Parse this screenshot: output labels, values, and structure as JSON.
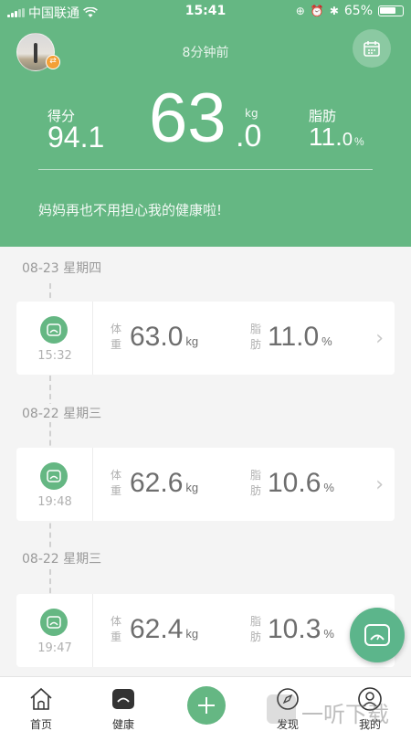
{
  "status_bar": {
    "carrier": "中国联通",
    "time": "15:41",
    "battery": "65%"
  },
  "header": {
    "updated": "8分钟前",
    "score_label": "得分",
    "score_value": "94.1",
    "weight_unit": "kg",
    "weight_int": "63",
    "weight_dec": ".0",
    "fat_label": "脂肪",
    "fat_int": "11.",
    "fat_dec": "0",
    "fat_unit": "%",
    "slogan": "妈妈再也不用担心我的健康啦!"
  },
  "records": [
    {
      "date": "08-23 星期四",
      "time": "15:32",
      "weight_label": "体重",
      "weight": "63.0",
      "weight_unit": "kg",
      "fat_label": "脂肪",
      "fat": "11.0",
      "fat_unit": "%"
    },
    {
      "date": "08-22 星期三",
      "time": "19:48",
      "weight_label": "体重",
      "weight": "62.6",
      "weight_unit": "kg",
      "fat_label": "脂肪",
      "fat": "10.6",
      "fat_unit": "%"
    },
    {
      "date": "08-22 星期三",
      "time": "19:47",
      "weight_label": "体重",
      "weight": "62.4",
      "weight_unit": "kg",
      "fat_label": "脂肪",
      "fat": "10.3",
      "fat_unit": "%"
    }
  ],
  "tabs": [
    {
      "label": "首页",
      "icon": "home-icon"
    },
    {
      "label": "健康",
      "icon": "scale-icon"
    },
    {
      "label": "",
      "icon": "plus-icon"
    },
    {
      "label": "发现",
      "icon": "compass-icon"
    },
    {
      "label": "我的",
      "icon": "user-icon"
    }
  ],
  "watermark": "一听下载",
  "colors": {
    "accent": "#65b783",
    "fab": "#5cb58b"
  }
}
